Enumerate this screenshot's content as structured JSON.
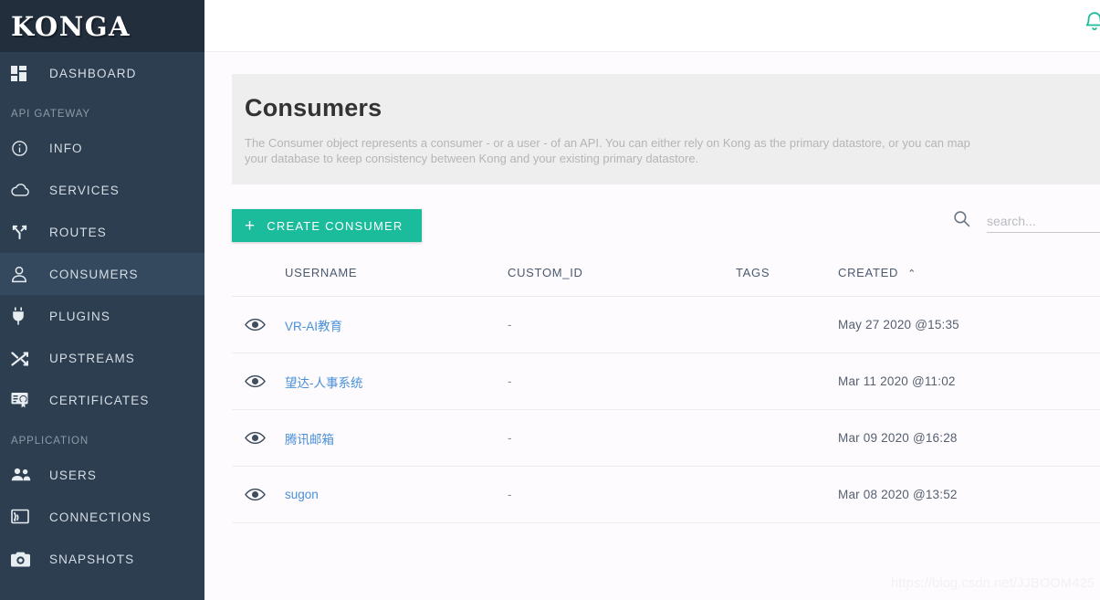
{
  "brand": {
    "name": "KONGA"
  },
  "topbar": {
    "bell_icon": "bell-icon"
  },
  "sidebar": {
    "top_items": [
      {
        "label": "DASHBOARD",
        "icon": "dashboard-grid-icon",
        "active": false
      }
    ],
    "sections": [
      {
        "title": "API GATEWAY",
        "items": [
          {
            "label": "INFO",
            "icon": "info-circle-icon",
            "active": false
          },
          {
            "label": "SERVICES",
            "icon": "cloud-icon",
            "active": false
          },
          {
            "label": "ROUTES",
            "icon": "routes-fork-icon",
            "active": false
          },
          {
            "label": "CONSUMERS",
            "icon": "user-icon",
            "active": true
          },
          {
            "label": "PLUGINS",
            "icon": "plug-icon",
            "active": false
          },
          {
            "label": "UPSTREAMS",
            "icon": "shuffle-icon",
            "active": false
          },
          {
            "label": "CERTIFICATES",
            "icon": "certificate-icon",
            "active": false
          }
        ]
      },
      {
        "title": "APPLICATION",
        "items": [
          {
            "label": "USERS",
            "icon": "users-group-icon",
            "active": false
          },
          {
            "label": "CONNECTIONS",
            "icon": "connection-cast-icon",
            "active": false
          },
          {
            "label": "SNAPSHOTS",
            "icon": "camera-icon",
            "active": false
          }
        ]
      }
    ]
  },
  "page": {
    "title": "Consumers",
    "description": "The Consumer object represents a consumer - or a user - of an API. You can either rely on Kong as the primary datastore, or you can map\nyour database to keep consistency between Kong and your existing primary datastore."
  },
  "toolbar": {
    "create_label": "CREATE CONSUMER",
    "create_plus": "+",
    "search_placeholder": "search...",
    "search_value": "",
    "search_icon": "search-icon"
  },
  "table": {
    "columns": [
      "",
      "USERNAME",
      "CUSTOM_ID",
      "TAGS",
      "CREATED"
    ],
    "sort_column": "CREATED",
    "sort_caret": "⌃",
    "rows": [
      {
        "username": "VR-AI教育",
        "custom_id": "-",
        "tags": "",
        "created": "May 27 2020 @15:35"
      },
      {
        "username": "望达-人事系统",
        "custom_id": "-",
        "tags": "",
        "created": "Mar 11 2020 @11:02"
      },
      {
        "username": "腾讯邮箱",
        "custom_id": "-",
        "tags": "",
        "created": "Mar 09 2020 @16:28"
      },
      {
        "username": "sugon",
        "custom_id": "-",
        "tags": "",
        "created": "Mar 08 2020 @13:52"
      }
    ]
  },
  "watermark": {
    "text": "https://blog.csdn.net/JJBOOM425"
  },
  "colors": {
    "sidebar_bg": "#2c3e50",
    "sidebar_brand_bg": "#222e3c",
    "sidebar_active": "#34495e",
    "accent": "#1abc9c",
    "link": "#4a90d9",
    "banner_bg": "#eeeeee"
  }
}
